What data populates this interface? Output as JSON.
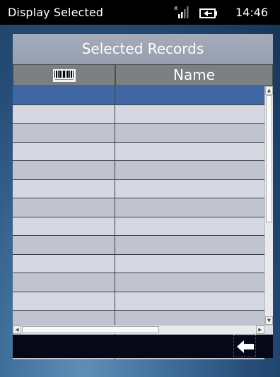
{
  "statusbar": {
    "title": "Display Selected",
    "time": "14:46",
    "icons": [
      "signal-off-icon",
      "battery-charging-icon"
    ]
  },
  "panel": {
    "title": "Selected Records",
    "columns": [
      {
        "icon": "barcode-icon",
        "label": ""
      },
      {
        "label": "Name"
      }
    ],
    "rows": [
      {
        "barcode": "",
        "name": "",
        "selected": true
      },
      {
        "barcode": "",
        "name": ""
      },
      {
        "barcode": "",
        "name": ""
      },
      {
        "barcode": "",
        "name": ""
      },
      {
        "barcode": "",
        "name": ""
      },
      {
        "barcode": "",
        "name": ""
      },
      {
        "barcode": "",
        "name": ""
      },
      {
        "barcode": "",
        "name": ""
      },
      {
        "barcode": "",
        "name": ""
      },
      {
        "barcode": "",
        "name": ""
      },
      {
        "barcode": "",
        "name": ""
      },
      {
        "barcode": "",
        "name": ""
      },
      {
        "barcode": "",
        "name": ""
      },
      {
        "barcode": "",
        "name": ""
      },
      {
        "barcode": "",
        "name": ""
      }
    ]
  },
  "toolbar": {
    "back_icon": "back-arrow-icon"
  },
  "colors": {
    "selected_row": "#3f67a3",
    "header": "#7b8183",
    "panel_title": "#9ea6b6"
  }
}
